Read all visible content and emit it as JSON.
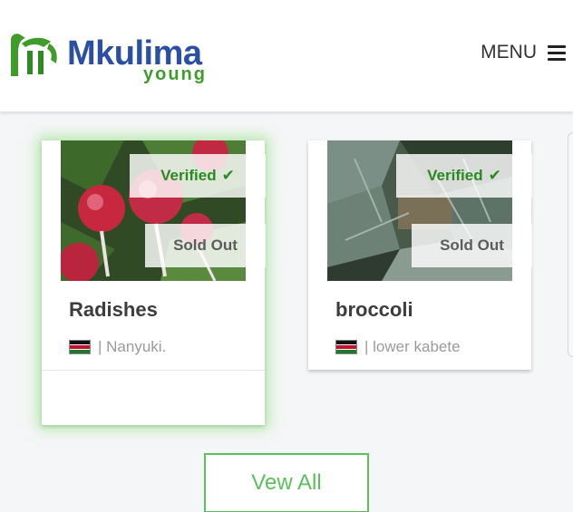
{
  "header": {
    "logo_text": "Mkulima",
    "logo_subtext": "young",
    "menu_label": "MENU"
  },
  "products": [
    {
      "verified_label": "Verified",
      "status_label": "Sold Out",
      "name": "Radishes",
      "location": "| Nanyuki."
    },
    {
      "verified_label": "Verified",
      "status_label": "Sold Out",
      "name": "broccoli",
      "location": "| lower kabete"
    }
  ],
  "view_all_label": "Vew All",
  "colors": {
    "brand_blue": "#2a4fa3",
    "brand_green": "#3f9b2a",
    "verified_green": "#2a8a22",
    "button_green": "#5bc25b"
  }
}
